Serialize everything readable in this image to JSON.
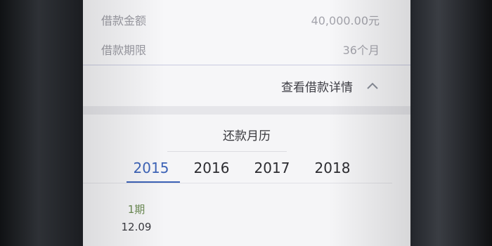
{
  "loan_info": {
    "amount_label": "借款金额",
    "amount_value": "40,000.00元",
    "term_label": "借款期限",
    "term_value": "36个月"
  },
  "details_toggle": {
    "label": "查看借款详情",
    "icon": "chevron-up-icon"
  },
  "calendar": {
    "title": "还款月历",
    "years": [
      "2015",
      "2016",
      "2017",
      "2018"
    ],
    "selected_year": "2015",
    "periods": [
      {
        "label": "1期",
        "date": "12.09"
      }
    ]
  },
  "colors": {
    "accent": "#3d63b7",
    "period_label": "#6b8a52",
    "muted_text": "#9b9ba3"
  }
}
